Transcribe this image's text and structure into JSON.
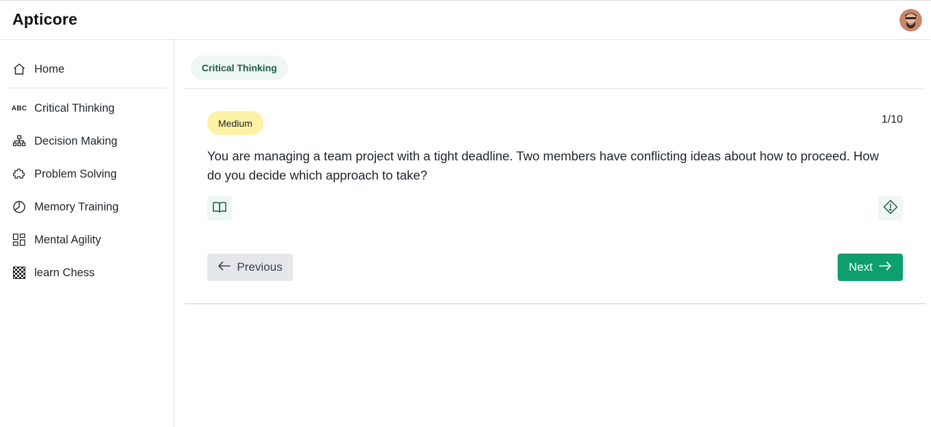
{
  "app": {
    "title": "Apticore"
  },
  "header": {
    "avatar_icon": "user-avatar"
  },
  "sidebar": {
    "items": [
      {
        "label": "Home",
        "icon": "home-icon"
      },
      {
        "label": "Critical Thinking",
        "icon": "abc-icon",
        "icon_text": "ABC"
      },
      {
        "label": "Decision Making",
        "icon": "hierarchy-icon"
      },
      {
        "label": "Problem Solving",
        "icon": "puzzle-icon"
      },
      {
        "label": "Memory Training",
        "icon": "pie-chart-icon"
      },
      {
        "label": "Mental Agility",
        "icon": "grid-icon"
      },
      {
        "label": "learn Chess",
        "icon": "chessboard-icon"
      }
    ]
  },
  "main": {
    "category": "Critical Thinking",
    "difficulty": "Medium",
    "progress": "1/10",
    "question": "You are managing a team project with a tight deadline. Two members have conflicting ideas about how to proceed. How do you decide which approach to take?",
    "prev_label": "Previous",
    "next_label": "Next"
  },
  "colors": {
    "accent": "#0e9f6e",
    "pill_bg": "#eef7f3",
    "difficulty_bg": "#fdf2a6",
    "secondary_btn_bg": "#e5e7eb"
  }
}
